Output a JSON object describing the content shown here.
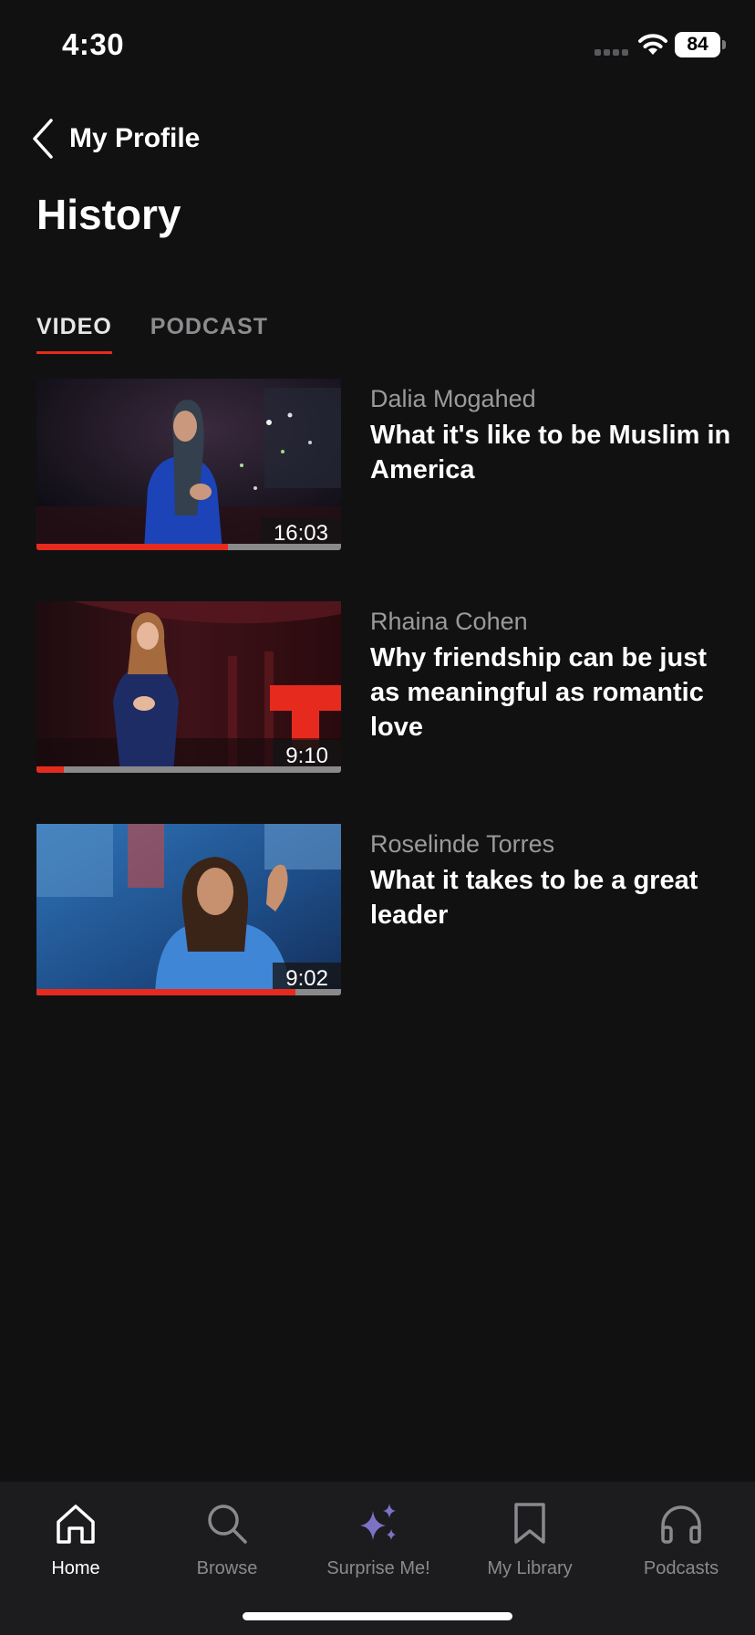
{
  "status_bar": {
    "time": "4:30",
    "battery": "84"
  },
  "header": {
    "back_label": "My Profile",
    "title": "History"
  },
  "tabs": [
    {
      "label": "VIDEO",
      "active": true
    },
    {
      "label": "PODCAST",
      "active": false
    }
  ],
  "videos": [
    {
      "speaker": "Dalia Mogahed",
      "title": "What it's like to be Muslim in America",
      "duration": "16:03",
      "progress": 0.63
    },
    {
      "speaker": "Rhaina Cohen",
      "title": "Why friendship can be just as meaningful as romantic love",
      "duration": "9:10",
      "progress": 0.09
    },
    {
      "speaker": "Roselinde Torres",
      "title": "What it takes to be a great leader",
      "duration": "9:02",
      "progress": 0.85
    }
  ],
  "tab_bar": [
    {
      "label": "Home",
      "icon": "home-icon",
      "active": true
    },
    {
      "label": "Browse",
      "icon": "search-icon",
      "active": false
    },
    {
      "label": "Surprise Me!",
      "icon": "sparkle-icon",
      "active": false
    },
    {
      "label": "My Library",
      "icon": "bookmark-icon",
      "active": false
    },
    {
      "label": "Podcasts",
      "icon": "headphones-icon",
      "active": false
    }
  ],
  "colors": {
    "accent": "#e62b1e",
    "background": "#111112",
    "tab_bar": "#1c1c1e",
    "sparkle": "#7c73c6"
  }
}
